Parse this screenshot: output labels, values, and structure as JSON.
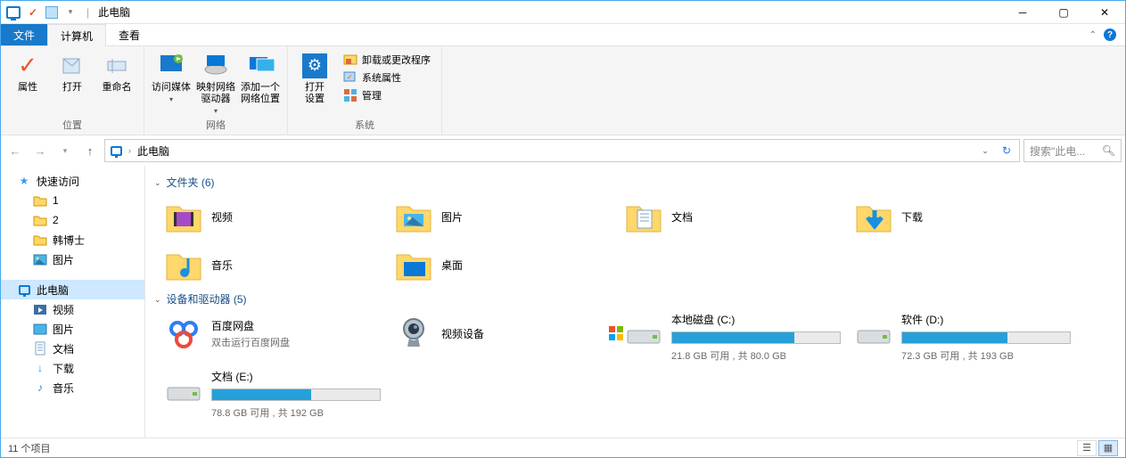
{
  "window": {
    "title": "此电脑"
  },
  "tabs": {
    "file": "文件",
    "computer": "计算机",
    "view": "查看"
  },
  "ribbon": {
    "groups": {
      "location": {
        "label": "位置",
        "properties": "属性",
        "open": "打开",
        "rename": "重命名"
      },
      "network": {
        "label": "网络",
        "media": "访问媒体",
        "map": "映射网络\n驱动器",
        "addloc": "添加一个\n网络位置"
      },
      "system": {
        "label": "系统",
        "settings": "打开\n设置",
        "uninstall": "卸载或更改程序",
        "sysprops": "系统属性",
        "manage": "管理"
      }
    }
  },
  "address": {
    "crumb": "此电脑"
  },
  "search": {
    "placeholder": "搜索\"此电..."
  },
  "sidebar": {
    "quick": "快速访问",
    "items_quick": [
      "1",
      "2",
      "韩博士",
      "图片"
    ],
    "thispc": "此电脑",
    "items_pc": [
      "视频",
      "图片",
      "文档",
      "下载",
      "音乐"
    ]
  },
  "content": {
    "folders_header": "文件夹 (6)",
    "folders": [
      "视频",
      "图片",
      "文档",
      "下载",
      "音乐",
      "桌面"
    ],
    "drives_header": "设备和驱动器 (5)",
    "baidu": {
      "title": "百度网盘",
      "sub": "双击运行百度网盘"
    },
    "video_device": "视频设备",
    "drives": [
      {
        "name": "本地磁盘 (C:)",
        "free": 21.8,
        "total": 80.0,
        "unit": "GB",
        "text": "21.8 GB 可用 , 共 80.0 GB"
      },
      {
        "name": "软件 (D:)",
        "free": 72.3,
        "total": 193,
        "unit": "GB",
        "text": "72.3 GB 可用 , 共 193 GB"
      },
      {
        "name": "文档 (E:)",
        "free": 78.8,
        "total": 192,
        "unit": "GB",
        "text": "78.8 GB 可用 , 共 192 GB"
      }
    ]
  },
  "status": {
    "text": "11 个项目"
  }
}
